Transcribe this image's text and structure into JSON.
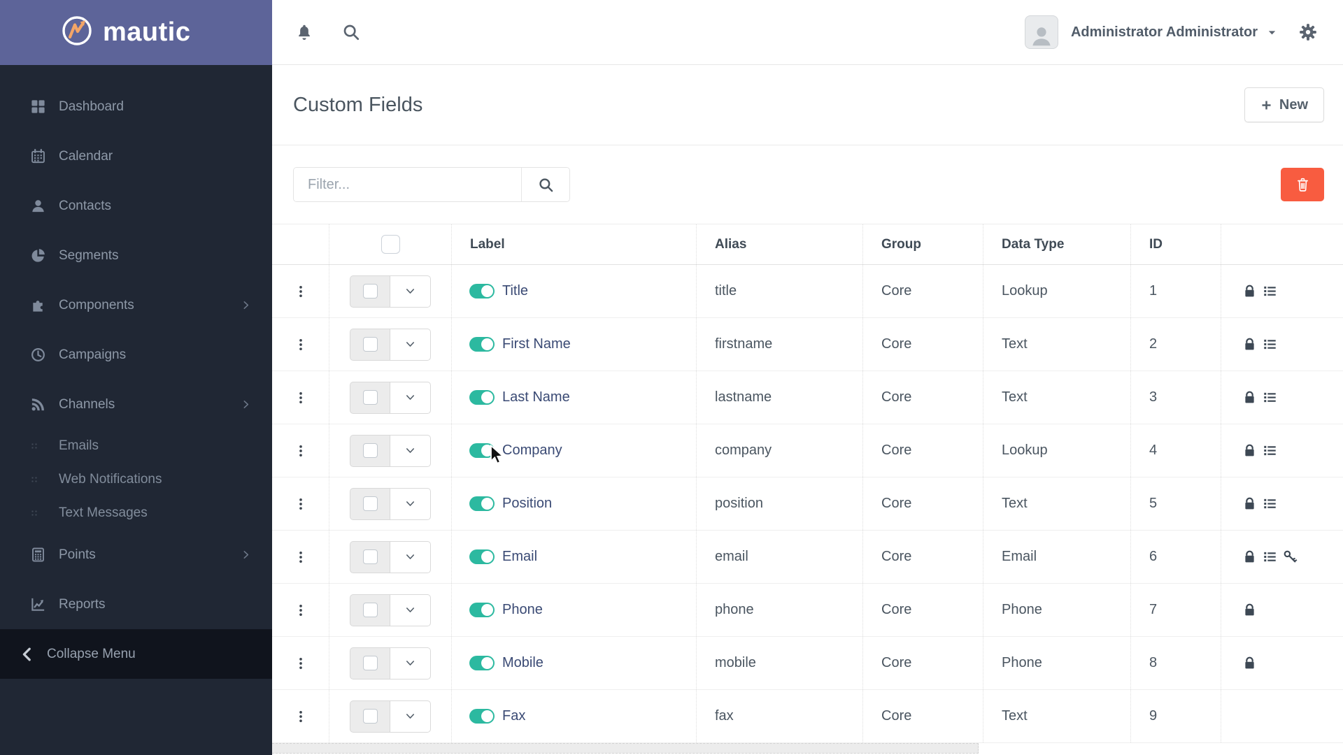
{
  "brand": {
    "name": "mautic"
  },
  "topbar": {
    "user_name": "Administrator Administrator"
  },
  "page": {
    "title": "Custom Fields",
    "new_button": "New"
  },
  "toolbar": {
    "filter_placeholder": "Filter..."
  },
  "sidebar": {
    "collapse_label": "Collapse Menu",
    "items": [
      {
        "label": "Dashboard",
        "icon": "dashboard-icon",
        "type": "main"
      },
      {
        "label": "Calendar",
        "icon": "calendar-icon",
        "type": "main"
      },
      {
        "label": "Contacts",
        "icon": "contacts-icon",
        "type": "main"
      },
      {
        "label": "Segments",
        "icon": "segments-icon",
        "type": "main"
      },
      {
        "label": "Components",
        "icon": "components-icon",
        "type": "main",
        "expandable": true
      },
      {
        "label": "Campaigns",
        "icon": "campaigns-icon",
        "type": "main"
      },
      {
        "label": "Channels",
        "icon": "channels-icon",
        "type": "main",
        "expandable": true
      },
      {
        "label": "Emails",
        "type": "sub"
      },
      {
        "label": "Web Notifications",
        "type": "sub"
      },
      {
        "label": "Text Messages",
        "type": "sub"
      },
      {
        "label": "Points",
        "icon": "points-icon",
        "type": "main",
        "expandable": true
      },
      {
        "label": "Reports",
        "icon": "reports-icon",
        "type": "main"
      }
    ]
  },
  "table": {
    "columns": [
      {
        "key": "menu",
        "label": ""
      },
      {
        "key": "select",
        "label": ""
      },
      {
        "key": "label",
        "label": "Label"
      },
      {
        "key": "alias",
        "label": "Alias"
      },
      {
        "key": "group",
        "label": "Group"
      },
      {
        "key": "data_type",
        "label": "Data Type"
      },
      {
        "key": "id",
        "label": "ID"
      },
      {
        "key": "flags",
        "label": ""
      }
    ],
    "rows": [
      {
        "label": "Title",
        "alias": "title",
        "group": "Core",
        "data_type": "Lookup",
        "id": "1",
        "enabled": true,
        "flags": [
          "lock-icon",
          "list-icon"
        ]
      },
      {
        "label": "First Name",
        "alias": "firstname",
        "group": "Core",
        "data_type": "Text",
        "id": "2",
        "enabled": true,
        "flags": [
          "lock-icon",
          "list-icon"
        ]
      },
      {
        "label": "Last Name",
        "alias": "lastname",
        "group": "Core",
        "data_type": "Text",
        "id": "3",
        "enabled": true,
        "flags": [
          "lock-icon",
          "list-icon"
        ]
      },
      {
        "label": "Company",
        "alias": "company",
        "group": "Core",
        "data_type": "Lookup",
        "id": "4",
        "enabled": true,
        "flags": [
          "lock-icon",
          "list-icon"
        ],
        "cursor": true
      },
      {
        "label": "Position",
        "alias": "position",
        "group": "Core",
        "data_type": "Text",
        "id": "5",
        "enabled": true,
        "flags": [
          "lock-icon",
          "list-icon"
        ]
      },
      {
        "label": "Email",
        "alias": "email",
        "group": "Core",
        "data_type": "Email",
        "id": "6",
        "enabled": true,
        "flags": [
          "lock-icon",
          "list-icon",
          "key-icon"
        ]
      },
      {
        "label": "Phone",
        "alias": "phone",
        "group": "Core",
        "data_type": "Phone",
        "id": "7",
        "enabled": true,
        "flags": [
          "lock-icon"
        ]
      },
      {
        "label": "Mobile",
        "alias": "mobile",
        "group": "Core",
        "data_type": "Phone",
        "id": "8",
        "enabled": true,
        "flags": [
          "lock-icon"
        ]
      },
      {
        "label": "Fax",
        "alias": "fax",
        "group": "Core",
        "data_type": "Text",
        "id": "9",
        "enabled": true,
        "flags": []
      }
    ]
  },
  "colors": {
    "brand_purple": "#5d6499",
    "sidebar_bg": "#202734",
    "toggle_on": "#2cb9a0",
    "danger": "#f85c40",
    "link": "#3a4a74"
  }
}
